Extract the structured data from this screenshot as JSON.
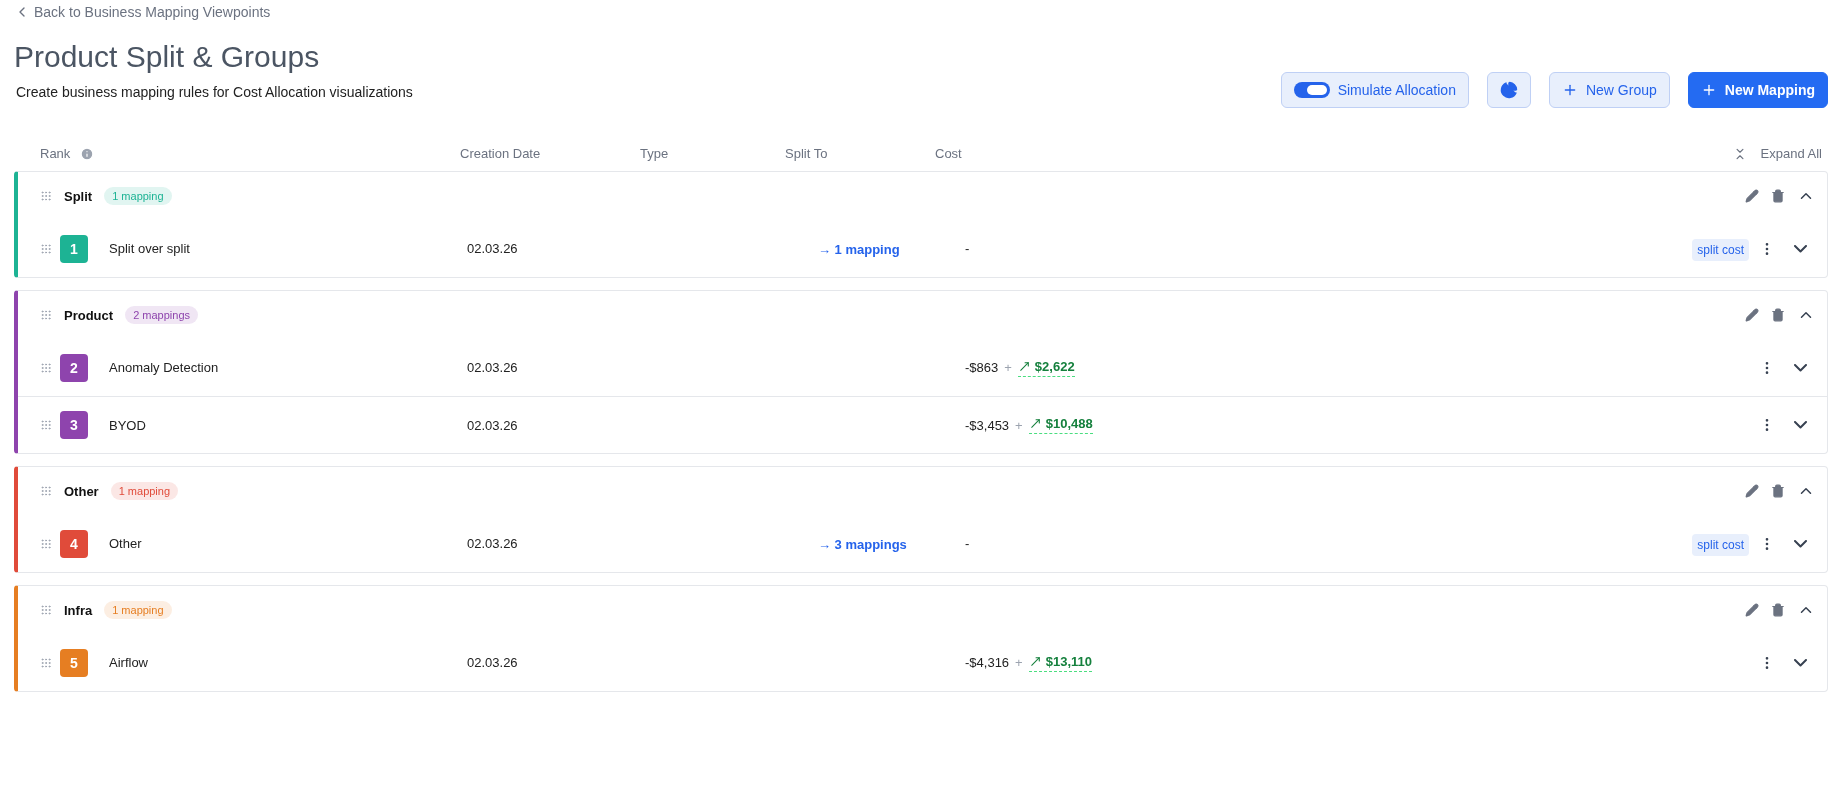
{
  "back_link": "Back to Business Mapping Viewpoints",
  "title": "Product Split & Groups",
  "subtitle": "Create business mapping rules for Cost Allocation visualizations",
  "actions": {
    "simulate": {
      "label": "Simulate Allocation",
      "on": true
    },
    "new_group": "New Group",
    "new_mapping": "New Mapping"
  },
  "columns": [
    "Rank",
    "Creation Date",
    "Type",
    "Split To",
    "Cost"
  ],
  "expand_all": "Expand All",
  "groups": [
    {
      "name": "Split",
      "count": "1 mapping",
      "color": "#1db394",
      "expanded": true,
      "rows": [
        {
          "rank": "1",
          "name": "Split over split",
          "date": "02.03.26",
          "split_to": "→ 1 mapping",
          "cost": "-",
          "tag": "split cost"
        }
      ]
    },
    {
      "name": "Product",
      "count": "2 mappings",
      "color": "#8e44ad",
      "expanded": true,
      "rows": [
        {
          "rank": "2",
          "name": "Anomaly Detection",
          "date": "02.03.26",
          "cost": "-$863",
          "plus": "+",
          "delta": "$2,622"
        },
        {
          "rank": "3",
          "name": "BYOD",
          "date": "02.03.26",
          "cost": "-$3,453",
          "plus": "+",
          "delta": "$10,488"
        }
      ]
    },
    {
      "name": "Other",
      "count": "1 mapping",
      "color": "#e04b3a",
      "expanded": true,
      "rows": [
        {
          "rank": "4",
          "name": "Other",
          "date": "02.03.26",
          "split_to": "→ 3 mappings",
          "cost": "-",
          "tag": "split cost"
        }
      ]
    },
    {
      "name": "Infra",
      "count": "1 mapping",
      "color": "#e67e22",
      "expanded": true,
      "rows": [
        {
          "rank": "5",
          "name": "Airflow",
          "date": "02.03.26",
          "cost": "-$4,316",
          "plus": "+",
          "delta": "$13,110"
        }
      ]
    }
  ]
}
